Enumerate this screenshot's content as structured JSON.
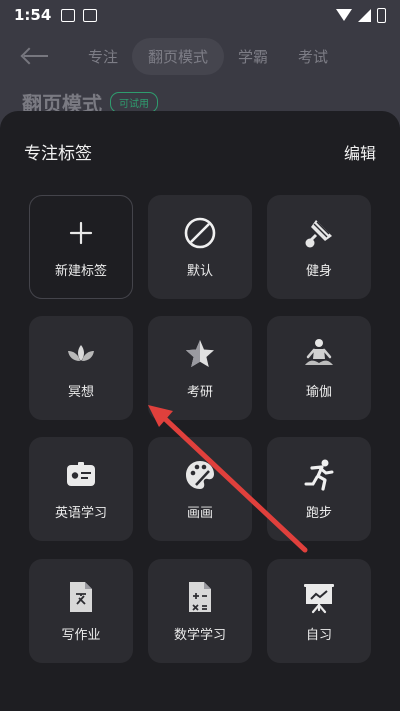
{
  "status_bar": {
    "time": "1:54"
  },
  "background": {
    "tabs": [
      "专注",
      "翻页模式",
      "学霸",
      "考试"
    ],
    "active_tab_index": 1,
    "title": "翻页模式",
    "badge": "可试用"
  },
  "sheet": {
    "title": "专注标签",
    "edit_label": "编辑",
    "tiles": [
      {
        "label": "新建标签",
        "icon": "plus-icon"
      },
      {
        "label": "默认",
        "icon": "circle-slash-icon"
      },
      {
        "label": "健身",
        "icon": "shuttlecock-icon"
      },
      {
        "label": "冥想",
        "icon": "lotus-icon"
      },
      {
        "label": "考研",
        "icon": "star-icon"
      },
      {
        "label": "瑜伽",
        "icon": "yoga-icon"
      },
      {
        "label": "英语学习",
        "icon": "id-card-icon"
      },
      {
        "label": "画画",
        "icon": "palette-icon"
      },
      {
        "label": "跑步",
        "icon": "runner-icon"
      },
      {
        "label": "写作业",
        "icon": "document-icon"
      },
      {
        "label": "数学学习",
        "icon": "calculator-icon"
      },
      {
        "label": "自习",
        "icon": "presentation-board-icon"
      }
    ]
  },
  "annotation_color": "#e0403c"
}
